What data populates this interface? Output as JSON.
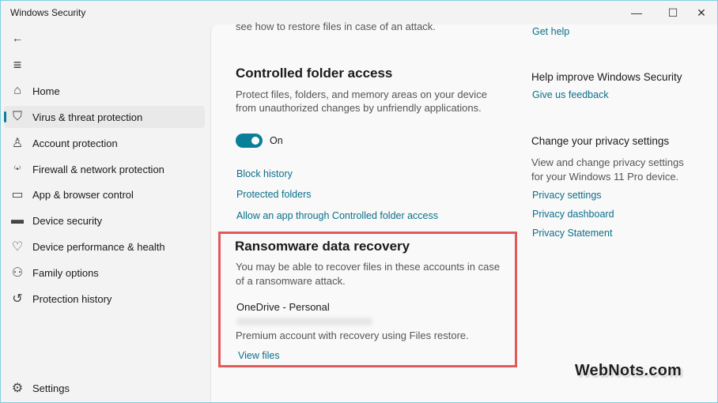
{
  "window": {
    "title": "Windows Security",
    "minimize": "—",
    "maximize": "☐",
    "close": "✕"
  },
  "sidebar": {
    "back": "←",
    "menu": "≡",
    "items": [
      {
        "label": "Home",
        "icon": "home-icon",
        "glyph": "⌂"
      },
      {
        "label": "Virus & threat protection",
        "icon": "shield-icon",
        "glyph": "⛉",
        "active": true
      },
      {
        "label": "Account protection",
        "icon": "person-icon",
        "glyph": "♙"
      },
      {
        "label": "Firewall & network protection",
        "icon": "wifi-icon",
        "glyph": "⁽•⁾"
      },
      {
        "label": "App & browser control",
        "icon": "browser-icon",
        "glyph": "▭"
      },
      {
        "label": "Device security",
        "icon": "laptop-icon",
        "glyph": "▬"
      },
      {
        "label": "Device performance & health",
        "icon": "heart-pulse-icon",
        "glyph": "♡"
      },
      {
        "label": "Family options",
        "icon": "family-icon",
        "glyph": "⚇"
      },
      {
        "label": "Protection history",
        "icon": "history-icon",
        "glyph": "↺"
      }
    ],
    "settings": {
      "label": "Settings",
      "icon": "gear-icon",
      "glyph": "⚙"
    }
  },
  "main": {
    "top_text": "see how to restore files in case of an attack.",
    "cfa": {
      "heading": "Controlled folder access",
      "desc1": "Protect files, folders, and memory areas on your device",
      "desc2": "from unauthorized changes by unfriendly applications.",
      "toggle_label": "On",
      "links": [
        "Block history",
        "Protected folders",
        "Allow an app through Controlled folder access"
      ]
    },
    "recovery": {
      "heading": "Ransomware data recovery",
      "desc1": "You may be able to recover files in these accounts in case",
      "desc2": "of a ransomware attack.",
      "account": "OneDrive - Personal",
      "account_note": "Premium account with recovery using Files restore.",
      "view_link": "View files"
    }
  },
  "right": {
    "get_help": "Get help",
    "improve_heading": "Help improve Windows Security",
    "feedback_link": "Give us feedback",
    "privacy_heading": "Change your privacy settings",
    "privacy_desc1": "View and change privacy settings",
    "privacy_desc2": "for your Windows 11 Pro device.",
    "privacy_links": [
      "Privacy settings",
      "Privacy dashboard",
      "Privacy Statement"
    ]
  },
  "watermark": "WebNots.com",
  "colors": {
    "accent": "#0a7f98",
    "link": "#0a6f8a",
    "highlight": "#e05a5a"
  }
}
